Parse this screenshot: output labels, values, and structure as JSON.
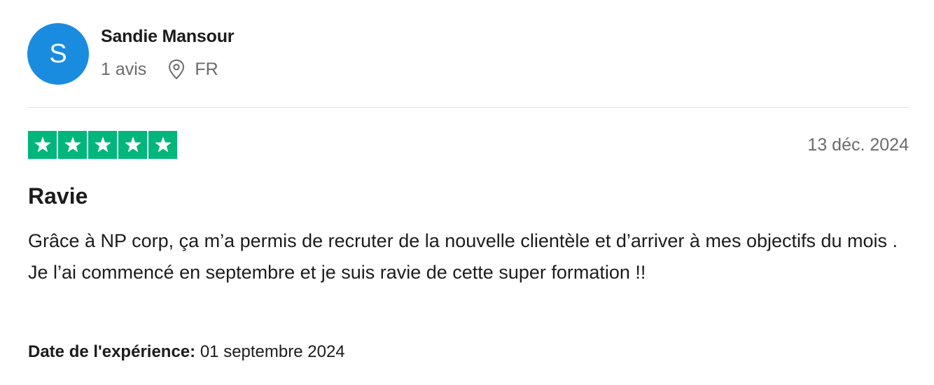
{
  "reviewer": {
    "initial": "S",
    "name": "Sandie Mansour",
    "reviews_count": "1 avis",
    "country": "FR",
    "avatar_color": "#1a8ce0"
  },
  "rating": {
    "stars": 5,
    "max": 5,
    "color": "#00b67a",
    "icon": "star-icon"
  },
  "review": {
    "date": "13 déc. 2024",
    "title": "Ravie",
    "body": [
      "Grâce à NP corp, ça m’a permis de recruter de la nouvelle clientèle et d’arriver à mes objectifs du mois .",
      "Je l’ai commencé en septembre et je suis ravie de cette super formation !!"
    ],
    "experience_label": "Date de l'expérience:",
    "experience_date": "01 septembre 2024"
  }
}
